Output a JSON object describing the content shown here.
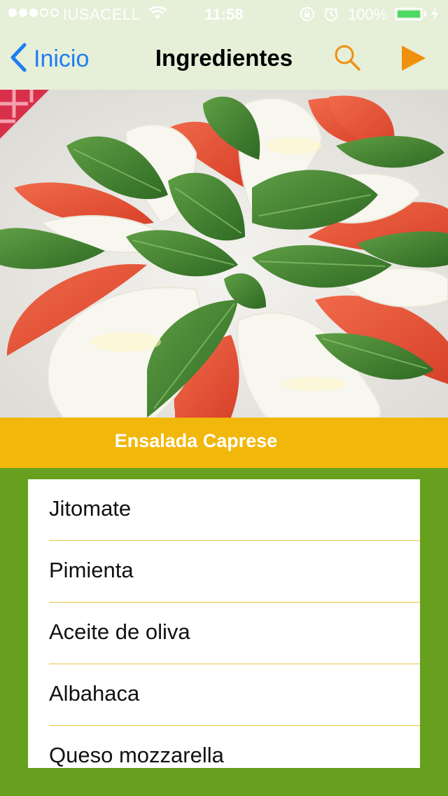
{
  "status": {
    "signal_bars_full": 3,
    "signal_bars_total": 5,
    "carrier": "IUSACELL",
    "time": "11:58",
    "battery_percent": "100%",
    "battery_color": "#4cd964"
  },
  "nav": {
    "back_label": "Inicio",
    "title": "Ingredientes",
    "search_icon": "search-icon",
    "play_icon": "play-icon",
    "accent_color": "#1e7ef2",
    "action_color": "#f0900f"
  },
  "recipe": {
    "name": "Ensalada Caprese",
    "image_subject": "caprese-salad-photo"
  },
  "ingredients": [
    {
      "label": "Jitomate"
    },
    {
      "label": "Pimienta"
    },
    {
      "label": "Aceite de oliva"
    },
    {
      "label": "Albahaca"
    },
    {
      "label": "Queso mozzarella"
    }
  ],
  "colors": {
    "nav_background": "#e6efd8",
    "title_bar": "#f2b70b",
    "list_background": "#66a01e",
    "separator": "#e6c24a"
  }
}
